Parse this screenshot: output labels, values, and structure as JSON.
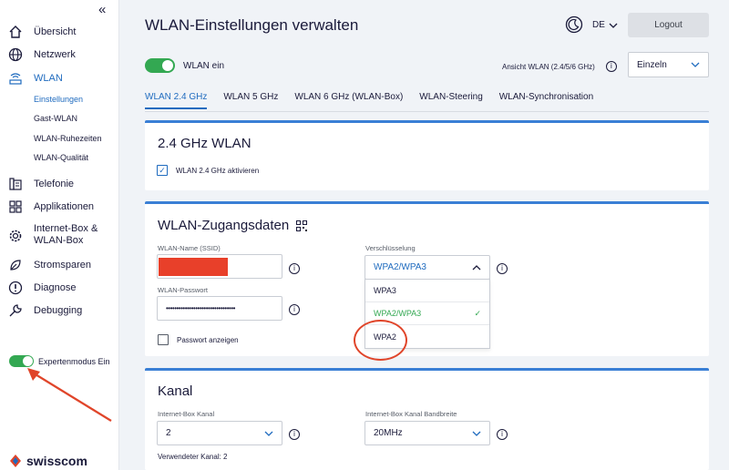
{
  "sidebar": {
    "collapse_label": "«",
    "items": [
      {
        "label": "Übersicht",
        "icon": "home-icon"
      },
      {
        "label": "Netzwerk",
        "icon": "globe-icon"
      },
      {
        "label": "WLAN",
        "icon": "wifi-router-icon"
      },
      {
        "label": "Telefonie",
        "icon": "phone-icon"
      },
      {
        "label": "Applikationen",
        "icon": "apps-grid-icon"
      },
      {
        "label": "Internet-Box &",
        "label2": "WLAN-Box",
        "icon": "gear-icon"
      },
      {
        "label": "Stromsparen",
        "icon": "leaf-icon"
      },
      {
        "label": "Diagnose",
        "icon": "alert-icon"
      },
      {
        "label": "Debugging",
        "icon": "wrench-icon"
      }
    ],
    "sub_items": [
      "Einstellungen",
      "Gast-WLAN",
      "WLAN-Ruhezeiten",
      "WLAN-Qualität"
    ],
    "expert_label": "Expertenmodus Ein",
    "logo_text": "swisscom"
  },
  "header": {
    "title": "WLAN-Einstellungen verwalten",
    "lang": "DE",
    "logout_label": "Logout",
    "wlan_toggle_label": "WLAN ein",
    "ansicht_label": "Ansicht WLAN (2.4/5/6 GHz)",
    "ansicht_value": "Einzeln"
  },
  "tabs": [
    "WLAN 2.4 GHz",
    "WLAN 5 GHz",
    "WLAN 6 GHz (WLAN-Box)",
    "WLAN-Steering",
    "WLAN-Synchronisation"
  ],
  "card1": {
    "title": "2.4 GHz WLAN",
    "checkbox_label": "WLAN 2.4 GHz aktivieren"
  },
  "card2": {
    "title": "WLAN-Zugangsdaten",
    "ssid_label": "WLAN-Name (SSID)",
    "password_label": "WLAN-Passwort",
    "password_value": "•••••••••••••••••••••••••••••••••",
    "show_password_label": "Passwort anzeigen",
    "encryption_label": "Verschlüsselung",
    "encryption_value": "WPA2/WPA3",
    "options": [
      "WPA3",
      "WPA2/WPA3",
      "WPA2"
    ]
  },
  "card3": {
    "title": "Kanal",
    "channel_label": "Internet-Box Kanal",
    "channel_value": "2",
    "bandwidth_label": "Internet-Box Kanal Bandbreite",
    "bandwidth_value": "20MHz",
    "used_channel": "Verwendeter Kanal: 2"
  },
  "colors": {
    "accent": "#1f6bbf",
    "toggle": "#33a852",
    "annotation": "#e0452a",
    "redacted": "#e8402a"
  }
}
